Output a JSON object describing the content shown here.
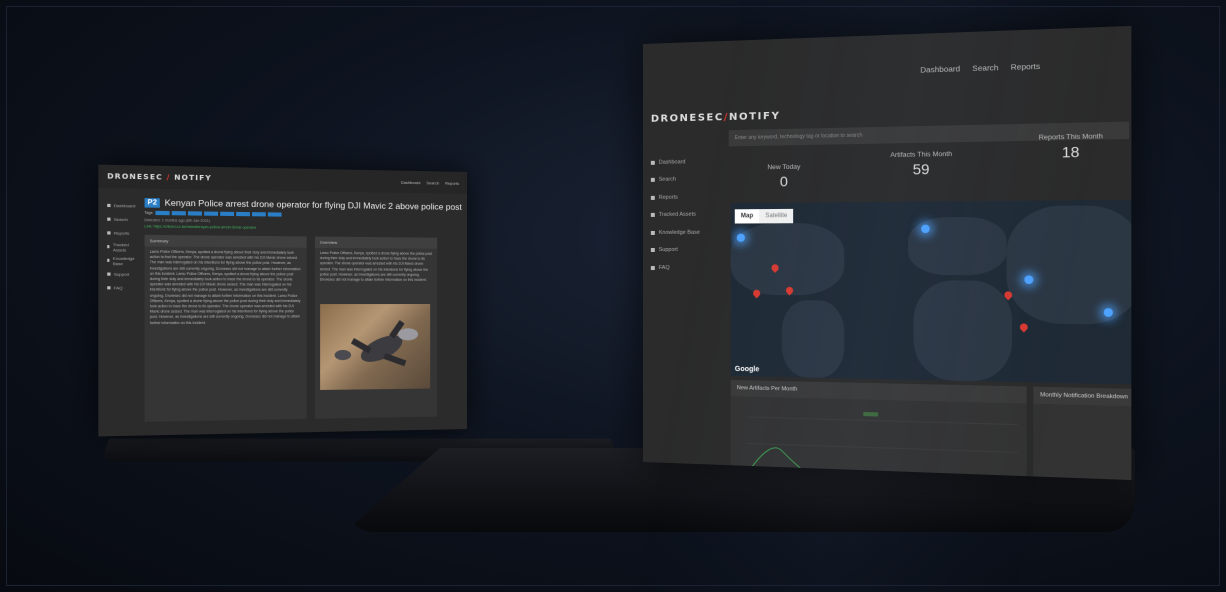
{
  "brand": {
    "logo_left": "DRONESEC",
    "logo_slash": "/",
    "logo_right": "NOTIFY"
  },
  "nav": {
    "dashboard": "Dashboard",
    "search": "Search",
    "reports": "Reports"
  },
  "sidebar": {
    "items": [
      {
        "label": "Dashboard",
        "icon": "home-icon"
      },
      {
        "label": "Search",
        "icon": "search-icon"
      },
      {
        "label": "Reports",
        "icon": "document-icon"
      },
      {
        "label": "Tracked Assets",
        "icon": "user-icon"
      },
      {
        "label": "Knowledge Base",
        "icon": "book-icon"
      },
      {
        "label": "Support",
        "icon": "support-icon"
      },
      {
        "label": "FAQ",
        "icon": "faq-icon"
      }
    ]
  },
  "article": {
    "priority": "P2",
    "title": "Kenyan Police arrest drone operator for flying DJI Mavic 2 above police post",
    "tags_label": "Tags:",
    "detected": "Detected: 1 months ago (6th Jan 2021)",
    "link": "Link: https://citizen.co.ke/news/kenyan-police-arrest-drone-operator",
    "summary_heading": "Summary",
    "summary_text": "Lamu Police Officers, Kenya, spotted a drone flying above their duty and immediately took action to find the operator. The drone operator was arrested with his DJI Mavic drone seized. The man was interrogated on his intentions for flying above the police post. However, as investigations are still currently ongoing, Dronesec did not manage to attain further information on this incident. Lamu Police Officers, Kenya, spotted a drone flying above the police post during their duty and immediately took action to trace the drone to its operator. The drone operator was arrested with his DJI Mavic drone seized. The man was interrogated on his intentions for flying above the police post. However, as investigations are still currently ongoing, Dronesec did not manage to attain further information on this incident. Lamu Police Officers, Kenya, spotted a drone flying above the police post during their duty and immediately took action to trace the drone to its operator. The drone operator was arrested with his DJI Mavic drone seized. The man was interrogated on his intentions for flying above the police post. However, as investigations are still currently ongoing, Dronesec did not manage to attain further information on this incident.",
    "overview_heading": "Overview",
    "overview_text": "Lamu Police Officers, Kenya, spotted a drone flying above the police post during their duty and immediately took action to trace the drone to its operator. The drone operator was arrested with his DJI Mavic drone seized. The man was interrogated on his intentions for flying above the police post. However, as investigations are still currently ongoing, Dronesec did not manage to attain further information on this incident."
  },
  "dashboard": {
    "search_placeholder": "Enter any keyword, technology tag or location to search",
    "stats": [
      {
        "label": "New Today",
        "value": "0"
      },
      {
        "label": "Artifacts This Month",
        "value": "59"
      },
      {
        "label": "Reports This Month",
        "value": "18"
      }
    ],
    "map_tabs": [
      "Map",
      "Satellite"
    ],
    "map_provider": "Google",
    "panels": {
      "artifacts": "New Artifacts Per Month",
      "notifications": "Monthly Notification Breakdown"
    }
  },
  "colors": {
    "accent_red": "#e0332d",
    "badge_blue": "#2a7ec6",
    "link_green": "#3fb35a",
    "pin_red": "#d83a31",
    "glow_blue": "#4ea3ff"
  }
}
